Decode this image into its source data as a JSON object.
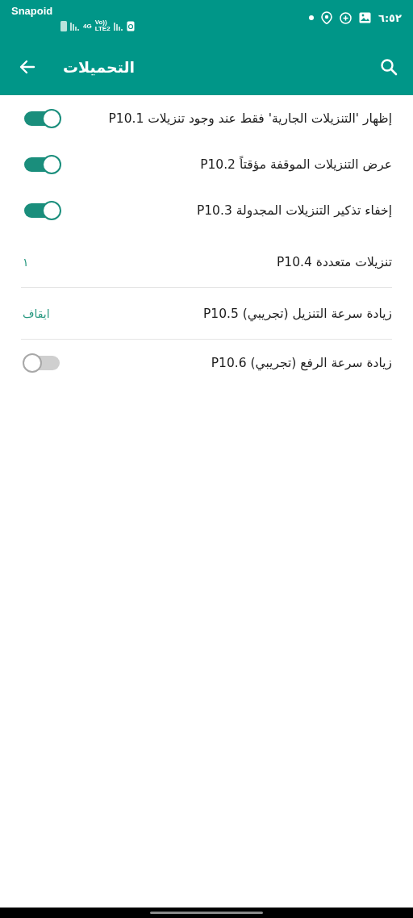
{
  "status_bar": {
    "app_name": "Snapoid",
    "network_1": "4G",
    "network_2": "Vo))",
    "network_3": "LTE2",
    "time": "٦:٥٢"
  },
  "app_bar": {
    "title": "التحميلات"
  },
  "items": [
    {
      "kind": "toggle",
      "label": "إظهار 'التنزيلات الجارية' فقط عند وجود تنزيلات P10.1",
      "on": true,
      "divider": false
    },
    {
      "kind": "toggle",
      "label": "عرض التنزيلات الموقفة مؤقتاً P10.2",
      "on": true,
      "divider": false
    },
    {
      "kind": "toggle",
      "label": "إخفاء تذكير التنزيلات المجدولة P10.3",
      "on": true,
      "divider": false
    },
    {
      "kind": "value",
      "label": "تنزيلات متعددة P10.4",
      "value": "١",
      "divider": true
    },
    {
      "kind": "value",
      "label": "زيادة سرعة التنزيل (تجريبي) P10.5",
      "value": "ايقاف",
      "divider": true
    },
    {
      "kind": "toggle",
      "label": "زيادة سرعة الرفع (تجريبي) P10.6",
      "on": false,
      "divider": false
    }
  ]
}
